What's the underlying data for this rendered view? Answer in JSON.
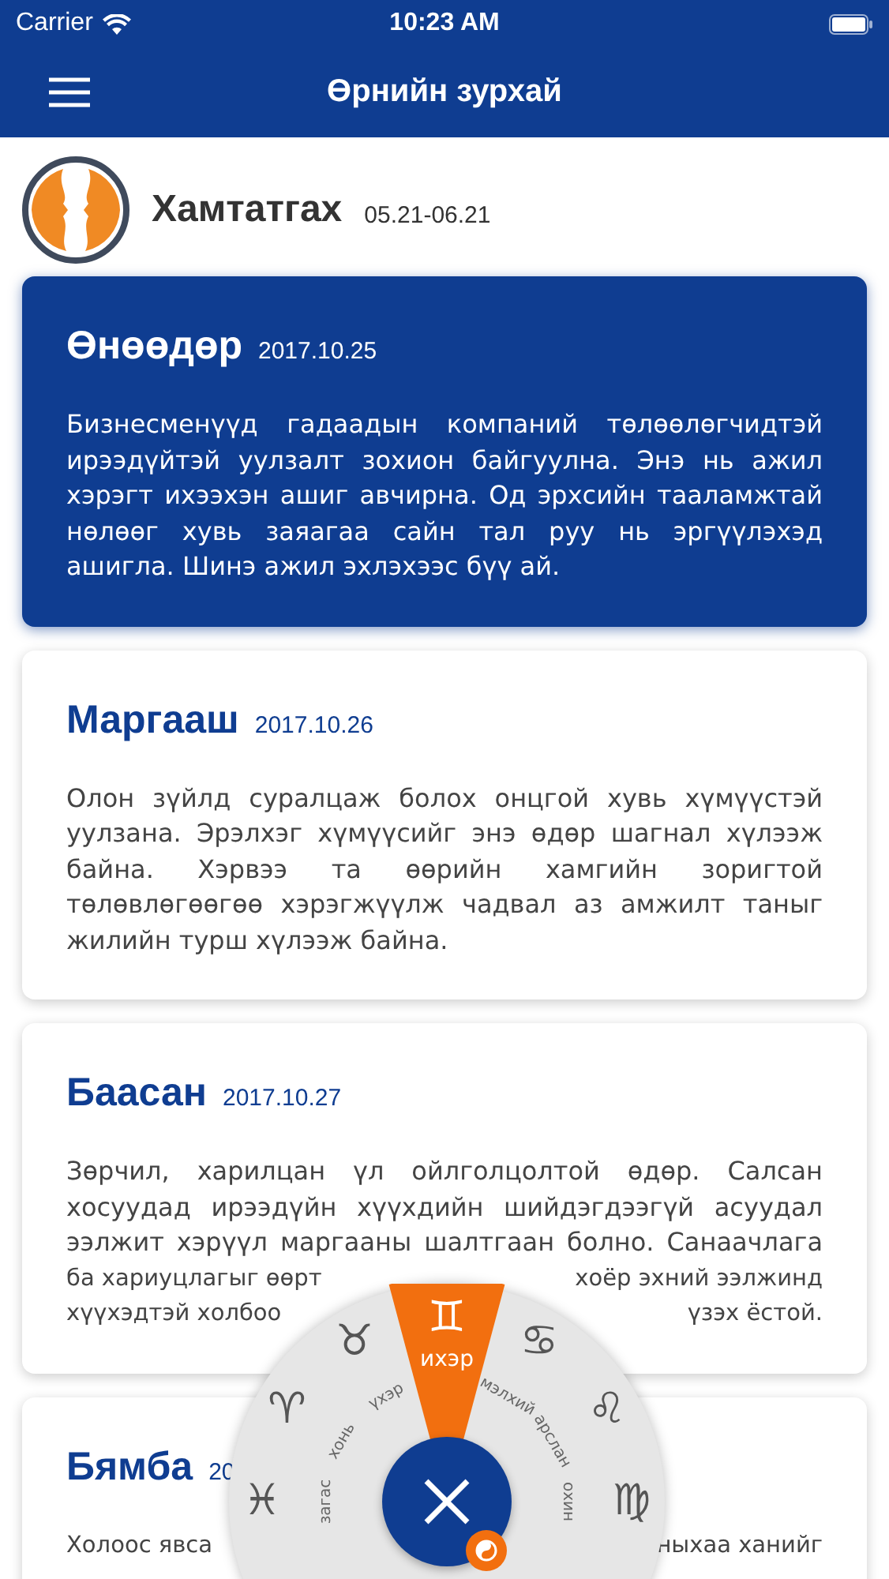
{
  "status_bar": {
    "carrier": "Carrier",
    "time": "10:23 AM"
  },
  "nav": {
    "title": "Өрнийн зурхай"
  },
  "sign": {
    "name": "Хамтатгах",
    "dates": "05.21-06.21"
  },
  "cards": [
    {
      "title": "Өнөөдөр",
      "date": "2017.10.25",
      "selected": true,
      "text": "Бизнесменүүд гадаадын компаний төлөөлөгчидтэй ирээдүйтэй уулзалт зохион байгуулна. Энэ нь ажил хэрэгт ихээхэн ашиг авчирна. Од эрхсийн тааламжтай нөлөөг хувь заяагаа сайн тал руу нь эргүүлэхэд ашигла. Шинэ ажил эхлэхээс бүү ай."
    },
    {
      "title": "Маргааш",
      "date": "2017.10.26",
      "selected": false,
      "text": "Олон зүйлд суралцаж болох онцгой хувь хүмүүстэй уулзана. Эрэлхэг хүмүүсийг энэ өдөр шагнал хүлээж байна. Хэрвээ та өөрийн хамгийн зоригтой төлөвлөгөөгөө хэрэгжүүлж чадвал аз амжилт таныг жилийн турш хүлээж байна."
    },
    {
      "title": "Баасан",
      "date": "2017.10.27",
      "selected": false,
      "text": "Зөрчил, харилцан үл ойлголцолтой өдөр. Салсан хосуудад ирээдүйн хүүхдийн шийдэгдээгүй асуудал ээлжит хэрүүл маргааны шалтгаан болно. Санаачлага",
      "split_lines": [
        {
          "left": "ба хариуцлагыг өөрт",
          "right": "хоёр эхний ээлжинд"
        },
        {
          "left": "хүүхэдтэй холбоо",
          "right": "үзэх ёстой."
        }
      ]
    },
    {
      "title": "Бямба",
      "date": "20",
      "selected": false,
      "split_lines": [
        {
          "left": "Холоос явса",
          "right": "ныхаа ханийг"
        }
      ]
    }
  ],
  "wheel": {
    "signs": [
      {
        "symbol": "♓",
        "label": "загас",
        "selected": false
      },
      {
        "symbol": "♈",
        "label": "хонь",
        "selected": false
      },
      {
        "symbol": "♉",
        "label": "үхэр",
        "selected": false
      },
      {
        "symbol": "♊",
        "label": "ихэр",
        "selected": true
      },
      {
        "symbol": "♋",
        "label": "мэлхий",
        "selected": false
      },
      {
        "symbol": "♌",
        "label": "арслан",
        "selected": false
      },
      {
        "symbol": "♍",
        "label": "охин",
        "selected": false
      }
    ]
  }
}
